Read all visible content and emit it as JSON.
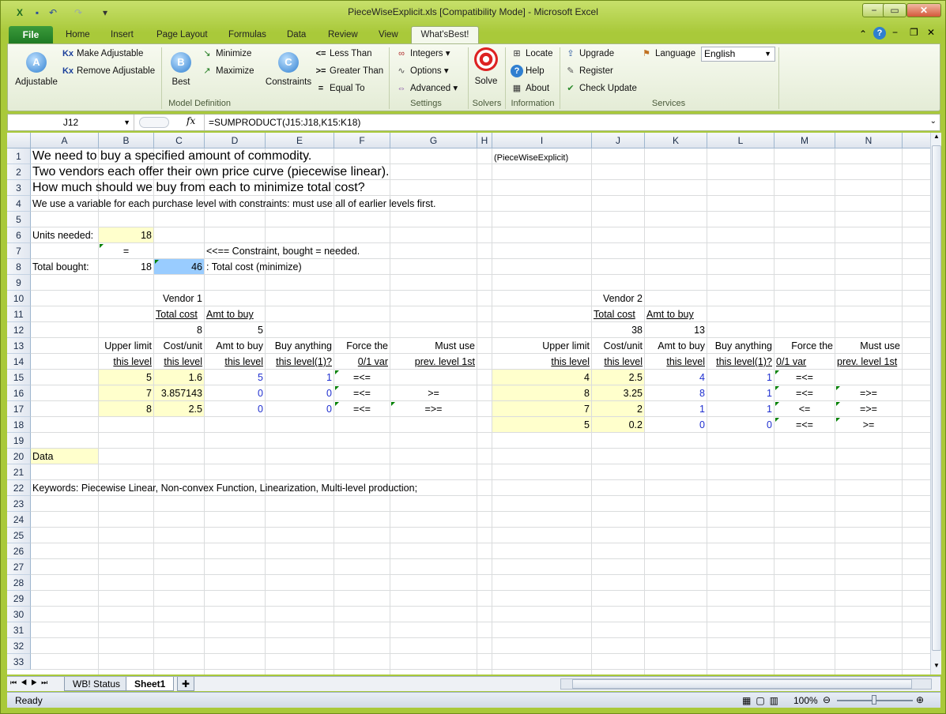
{
  "window": {
    "title": "PieceWiseExplicit.xls  [Compatibility Mode]  -  Microsoft Excel",
    "min": "−",
    "max": "▭",
    "close": "✕"
  },
  "tabs": {
    "file": "File",
    "items": [
      "Home",
      "Insert",
      "Page Layout",
      "Formulas",
      "Data",
      "Review",
      "View"
    ],
    "active": "What'sBest!"
  },
  "ribbon": {
    "adjustable": "Adjustable",
    "make_adjustable": "Make Adjustable",
    "remove_adjustable": "Remove Adjustable",
    "best": "Best",
    "minimize": "Minimize",
    "maximize": "Maximize",
    "constraints": "Constraints",
    "less_than": "Less Than",
    "greater_than": "Greater Than",
    "equal_to": "Equal To",
    "model_definition": "Model Definition",
    "integers": "Integers",
    "options": "Options",
    "advanced": "Advanced",
    "settings": "Settings",
    "solve": "Solve",
    "solvers": "Solvers",
    "locate": "Locate",
    "help": "Help",
    "about": "About",
    "information": "Information",
    "upgrade": "Upgrade",
    "register": "Register",
    "check_update": "Check Update",
    "language_label": "Language",
    "language_value": "English",
    "services": "Services"
  },
  "formula_bar": {
    "name_box": "J12",
    "fx": "fx",
    "formula": "=SUMPRODUCT(J15:J18,K15:K18)"
  },
  "columns": [
    "A",
    "B",
    "C",
    "D",
    "E",
    "F",
    "G",
    "H",
    "I",
    "J",
    "K",
    "L",
    "M",
    "N",
    "O"
  ],
  "rows": [
    "1",
    "2",
    "3",
    "4",
    "5",
    "6",
    "7",
    "8",
    "9",
    "10",
    "11",
    "12",
    "13",
    "14",
    "15",
    "16",
    "17",
    "18",
    "19",
    "20",
    "21",
    "22",
    "23",
    "24",
    "25",
    "26",
    "27",
    "28",
    "29",
    "30",
    "31",
    "32",
    "33"
  ],
  "cells": {
    "A1": "We need to buy a specified amount of commodity.",
    "I1": "(PieceWiseExplicit)",
    "A2": "Two vendors each offer their own price curve (piecewise linear).",
    "A3": "How much should we buy from each to minimize total cost?",
    "A4": "We use a variable for each purchase level with constraints: must use all of earlier levels first.",
    "A6": "Units needed:",
    "B6": "18",
    "B7": "=",
    "D7": "<<== Constraint, bought = needed.",
    "A8": "Total bought:",
    "B8": "18",
    "C8": "46",
    "D8": ": Total cost (minimize)",
    "C10": "Vendor 1",
    "C11": "Total cost",
    "D11": "Amt to buy",
    "C12": "8",
    "D12": "5",
    "B13": "Upper limit",
    "C13": "Cost/unit",
    "D13": "Amt to buy",
    "E13": "Buy anything",
    "F13": "Force the",
    "G13": "Must use",
    "B14": "this level",
    "C14": "this level",
    "D14": "this level",
    "E14": "this level(1)?",
    "F14": "0/1 var",
    "G14": "prev. level 1st",
    "B15": "5",
    "C15": "1.6",
    "D15": "5",
    "E15": "1",
    "F15": "=<=",
    "B16": "7",
    "C16": "3.857143",
    "D16": "0",
    "E16": "0",
    "F16": "=<=",
    "G16": ">=",
    "B17": "8",
    "C17": "2.5",
    "D17": "0",
    "E17": "0",
    "F17": "=<=",
    "G17": "=>=",
    "J10": "Vendor 2",
    "J11": "Total cost",
    "K11": "Amt to buy",
    "J12": "38",
    "K12": "13",
    "I13": "Upper limit",
    "J13": "Cost/unit",
    "K13": "Amt to buy",
    "L13": "Buy anything",
    "M13": "Force the",
    "N13": "Must use",
    "I14": "this level",
    "J14": "this level",
    "K14": "this level",
    "L14": "this level(1)?",
    "M14": "0/1 var",
    "N14": "prev. level 1st",
    "I15": "4",
    "J15": "2.5",
    "K15": "4",
    "L15": "1",
    "M15": "=<=",
    "I16": "8",
    "J16": "3.25",
    "K16": "8",
    "L16": "1",
    "M16": "=<=",
    "N16": "=>=",
    "I17": "7",
    "J17": "2",
    "K17": "1",
    "L17": "1",
    "M17": "<=",
    "N17": "=>=",
    "I18": "5",
    "J18": "0.2",
    "K18": "0",
    "L18": "0",
    "M18": "=<=",
    "N18": ">=",
    "A20": "Data",
    "A22": "Keywords: Piecewise Linear,  Non-convex Function, Linearization, Multi-level production;"
  },
  "sheet_tabs": [
    "WB! Status",
    "Sheet1"
  ],
  "active_sheet": "Sheet1",
  "status": {
    "ready": "Ready",
    "zoom": "100%"
  }
}
